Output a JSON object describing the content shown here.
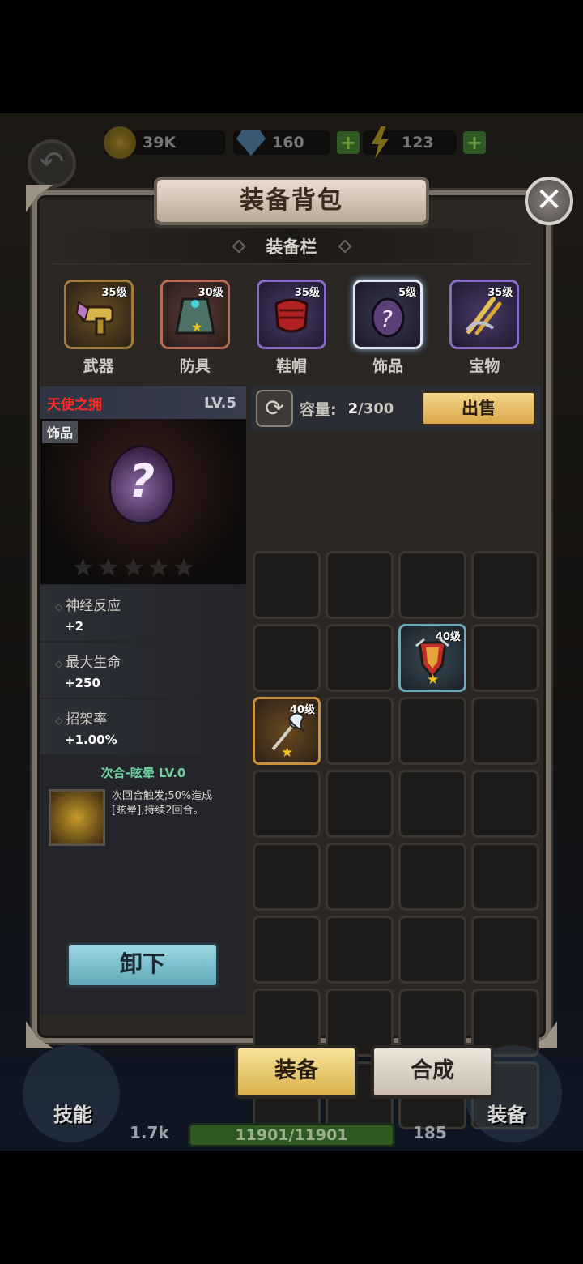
{
  "resources": {
    "gold": "39K",
    "gems": "160",
    "energy": "123",
    "plus": "+"
  },
  "title": "装备背包",
  "close": "✕",
  "back": "↶",
  "section_title": "装备栏",
  "slots": [
    {
      "level": "35级",
      "label": "武器",
      "icon": "blaster-icon"
    },
    {
      "level": "30级",
      "label": "防具",
      "icon": "cloak-icon"
    },
    {
      "level": "35级",
      "label": "鞋帽",
      "icon": "glove-icon"
    },
    {
      "level": "5级",
      "label": "饰品",
      "icon": "mystery-egg-icon"
    },
    {
      "level": "35级",
      "label": "宝物",
      "icon": "golden-claw-icon"
    }
  ],
  "item": {
    "name": "天使之拥",
    "level": "LV.5",
    "category": "饰品",
    "icon_glyph": "?",
    "stars_total": 5,
    "attributes": [
      {
        "name": "神经反应",
        "value": "+2"
      },
      {
        "name": "最大生命",
        "value": "+250"
      },
      {
        "name": "招架率",
        "value": "+1.00%"
      }
    ],
    "skill": {
      "title": "次合-眩晕 LV.0",
      "desc_line1": "次回合触发;50%造成",
      "desc_line2": "[眩晕],持续2回合。"
    },
    "unequip": "卸下"
  },
  "inventory": {
    "refresh_glyph": "⟳",
    "capacity_label": "容量:",
    "capacity_used": "2",
    "capacity_total": "/300",
    "sell": "出售",
    "items": [
      {
        "cell": 6,
        "level": "40级",
        "rarity": "blue",
        "icon": "shield-icon"
      },
      {
        "cell": 8,
        "level": "40级",
        "rarity": "orange",
        "icon": "staff-icon"
      }
    ],
    "total_cells": 32
  },
  "bottom": {
    "equip_tab": "装备",
    "forge_tab": "合成",
    "skills_label": "技能",
    "gear_label": "装备",
    "attack": "1.7k",
    "hp": "11901/11901",
    "defense": "185"
  },
  "colors": {
    "item_name": "#ff2a2a",
    "skill_title": "#6ed0a0",
    "sell_button": "#e8c06a",
    "unequip_button": "#7cc0cf"
  }
}
